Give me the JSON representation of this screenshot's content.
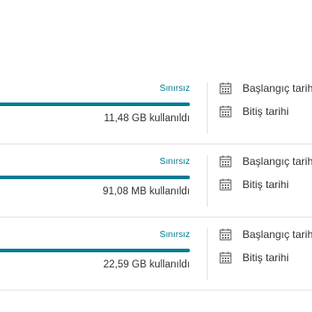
{
  "packages": [
    {
      "limit_label": "Sınırsız",
      "usage_text": "11,48 GB kullanıldı",
      "progress": 1.0,
      "start_label": "Başlangıç tarihi",
      "end_label": "Bitiş tarihi"
    },
    {
      "limit_label": "Sınırsız",
      "usage_text": "91,08 MB kullanıldı",
      "progress": 1.0,
      "start_label": "Başlangıç tarihi",
      "end_label": "Bitiş tarihi"
    },
    {
      "limit_label": "Sınırsız",
      "usage_text": "22,59 GB kullanıldı",
      "progress": 1.0,
      "start_label": "Başlangıç tarihi",
      "end_label": "Bitiş tarihi"
    }
  ],
  "colors": {
    "accent": "#007c92",
    "text": "#333333",
    "divider": "#e3e3e3"
  },
  "icons": {
    "date": "calendar-icon"
  }
}
